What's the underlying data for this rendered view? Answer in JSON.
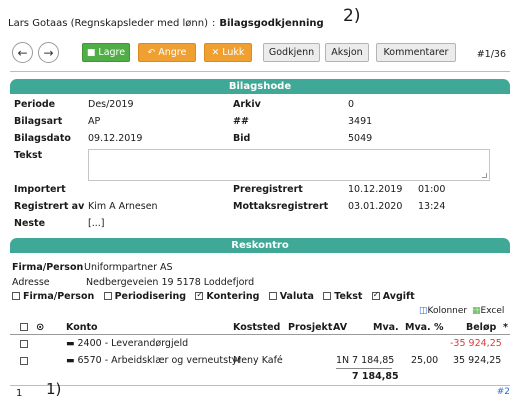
{
  "header": {
    "user": "Lars Gotaas (Regnskapsleder med lønn)",
    "separator": ":",
    "page_title": "Bilagsgodkjenning",
    "marker": "2)"
  },
  "toolbar": {
    "back_icon": "arrow-left-icon",
    "forward_icon": "arrow-right-icon",
    "save_label": "Lagre",
    "undo_label": "Angre",
    "close_label": "Lukk",
    "approve_label": "Godkjenn",
    "action_label": "Aksjon",
    "comments_label": "Kommentarer",
    "counter": "#1/36"
  },
  "bilagshode": {
    "title": "Bilagshode",
    "periode_label": "Periode",
    "periode": "Des/2019",
    "arkiv_label": "Arkiv",
    "arkiv": "0",
    "bilagsart_label": "Bilagsart",
    "bilagsart": "AP",
    "hash_label": "##",
    "hash": "3491",
    "bilagsdato_label": "Bilagsdato",
    "bilagsdato": "09.12.2019",
    "bid_label": "Bid",
    "bid": "5049",
    "tekst_label": "Tekst",
    "tekst": "",
    "importert_label": "Importert",
    "importert": "",
    "preregistrert_label": "Preregistrert",
    "preregistrert_date": "10.12.2019",
    "preregistrert_time": "01:00",
    "registrert_av_label": "Registrert av",
    "registrert_av": "Kim A Arnesen",
    "mottaksregistrert_label": "Mottaksregistrert",
    "mottaksregistrert_date": "03.01.2020",
    "mottaksregistrert_time": "13:24",
    "neste_label": "Neste",
    "neste": "[...]"
  },
  "reskontro": {
    "title": "Reskontro",
    "firma_label": "Firma/Person",
    "firma": "Uniformpartner AS",
    "adresse_label": "Adresse",
    "adresse": "Nedbergeveien 19 5178 Loddefjord"
  },
  "filters": [
    {
      "label": "Firma/Person",
      "checked": false
    },
    {
      "label": "Periodisering",
      "checked": false
    },
    {
      "label": "Kontering",
      "checked": true
    },
    {
      "label": "Valuta",
      "checked": false
    },
    {
      "label": "Tekst",
      "checked": false
    },
    {
      "label": "Avgift",
      "checked": true
    }
  ],
  "table_tools": {
    "columns_label": "Kolonner",
    "excel_label": "Excel"
  },
  "table": {
    "headers": {
      "konto": "Konto",
      "koststed": "Koststed",
      "prosjekt": "Prosjekt",
      "av": "AV",
      "mva": "Mva.",
      "mva_pct": "Mva. %",
      "belop": "Beløp",
      "star": "*"
    },
    "rows": [
      {
        "konto": "2400 - Leverandørgjeld",
        "koststed": "",
        "prosjekt": "",
        "av": "",
        "mva": "",
        "mva_pct": "",
        "belop": "-35 924,25",
        "negative": true
      },
      {
        "konto": "6570 - Arbeidsklær og verneutstyr",
        "koststed": "Meny Kafé",
        "prosjekt": "",
        "av": "1N",
        "mva": "7 184,85",
        "mva_pct": "25,00",
        "belop": "35 924,25",
        "negative": false
      }
    ],
    "total_mva": "7 184,85"
  },
  "footer": {
    "page_current": "1",
    "marker": "1)",
    "page_next": "#2"
  },
  "colors": {
    "section_bar": "#3fa896",
    "save_button": "#4fae45",
    "undo_button": "#f0a030",
    "negative_amount": "#e03a3a"
  }
}
